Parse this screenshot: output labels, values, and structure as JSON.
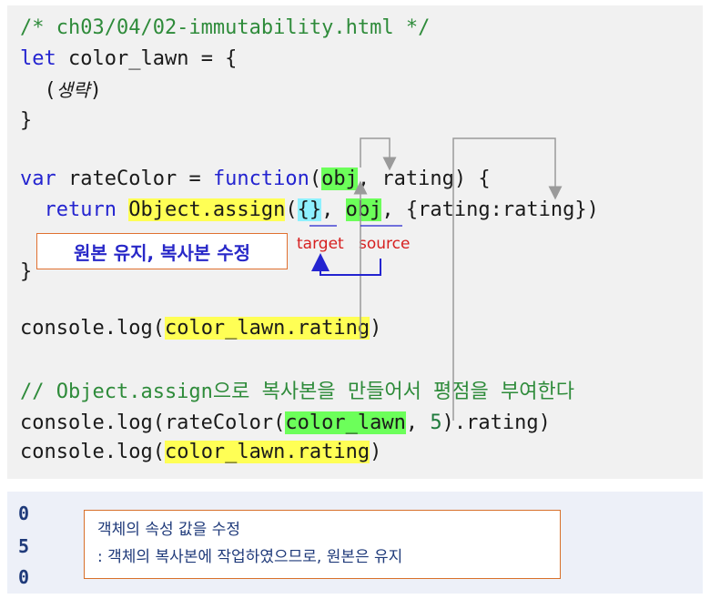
{
  "code": {
    "l1": "/* ch03/04/02-immutability.html */",
    "l2_kw": "let",
    "l2_rest": " color_lawn = {",
    "l3_open": "  (",
    "l3_italic": "생략",
    "l3_close": ")",
    "l4": "}",
    "l6_kw1": "var",
    "l6_a": " rateColor = ",
    "l6_kw2": "function",
    "l6_b": "(",
    "l6_obj": "obj",
    "l6_c": ", rating) {",
    "l7_kw": "  return",
    "l7_sp": " ",
    "l7_assign": "Object.assign",
    "l7_paren": "(",
    "l7_braces": "{}",
    "l7_comma": ", ",
    "l7_obj": "obj",
    "l7_rest": ", {rating:rating})",
    "l8": "}",
    "l10_a": "console.log(",
    "l10_hl": "color_lawn.rating",
    "l10_b": ")",
    "l12": "// Object.assign으로 복사본을 만들어서 평점을 부여한다",
    "l13_a": "console.log(rateColor(",
    "l13_hl": "color_lawn",
    "l13_b": ", ",
    "l13_num": "5",
    "l13_c": ").rating)",
    "l14_a": "console.log(",
    "l14_hl": "color_lawn.rating",
    "l14_b": ")"
  },
  "annotations": {
    "keep_original": "원본 유지, 복사본 수정",
    "target": "target",
    "source": "source"
  },
  "output": {
    "lines": [
      "0",
      "5",
      "0"
    ],
    "note_line1": "객체의 속성 값을 수정",
    "note_line2": ": 객체의 복사본에 작업하였으므로, 원본은 유지"
  },
  "colors": {
    "comment": "#2e8b3a",
    "keyword": "#2424d0",
    "highlight_yellow": "#ffff55",
    "highlight_green": "#6cff5a",
    "highlight_cyan": "#8ef0ff",
    "annotation_red": "#d62020",
    "arrow_blue": "#2424d0"
  }
}
